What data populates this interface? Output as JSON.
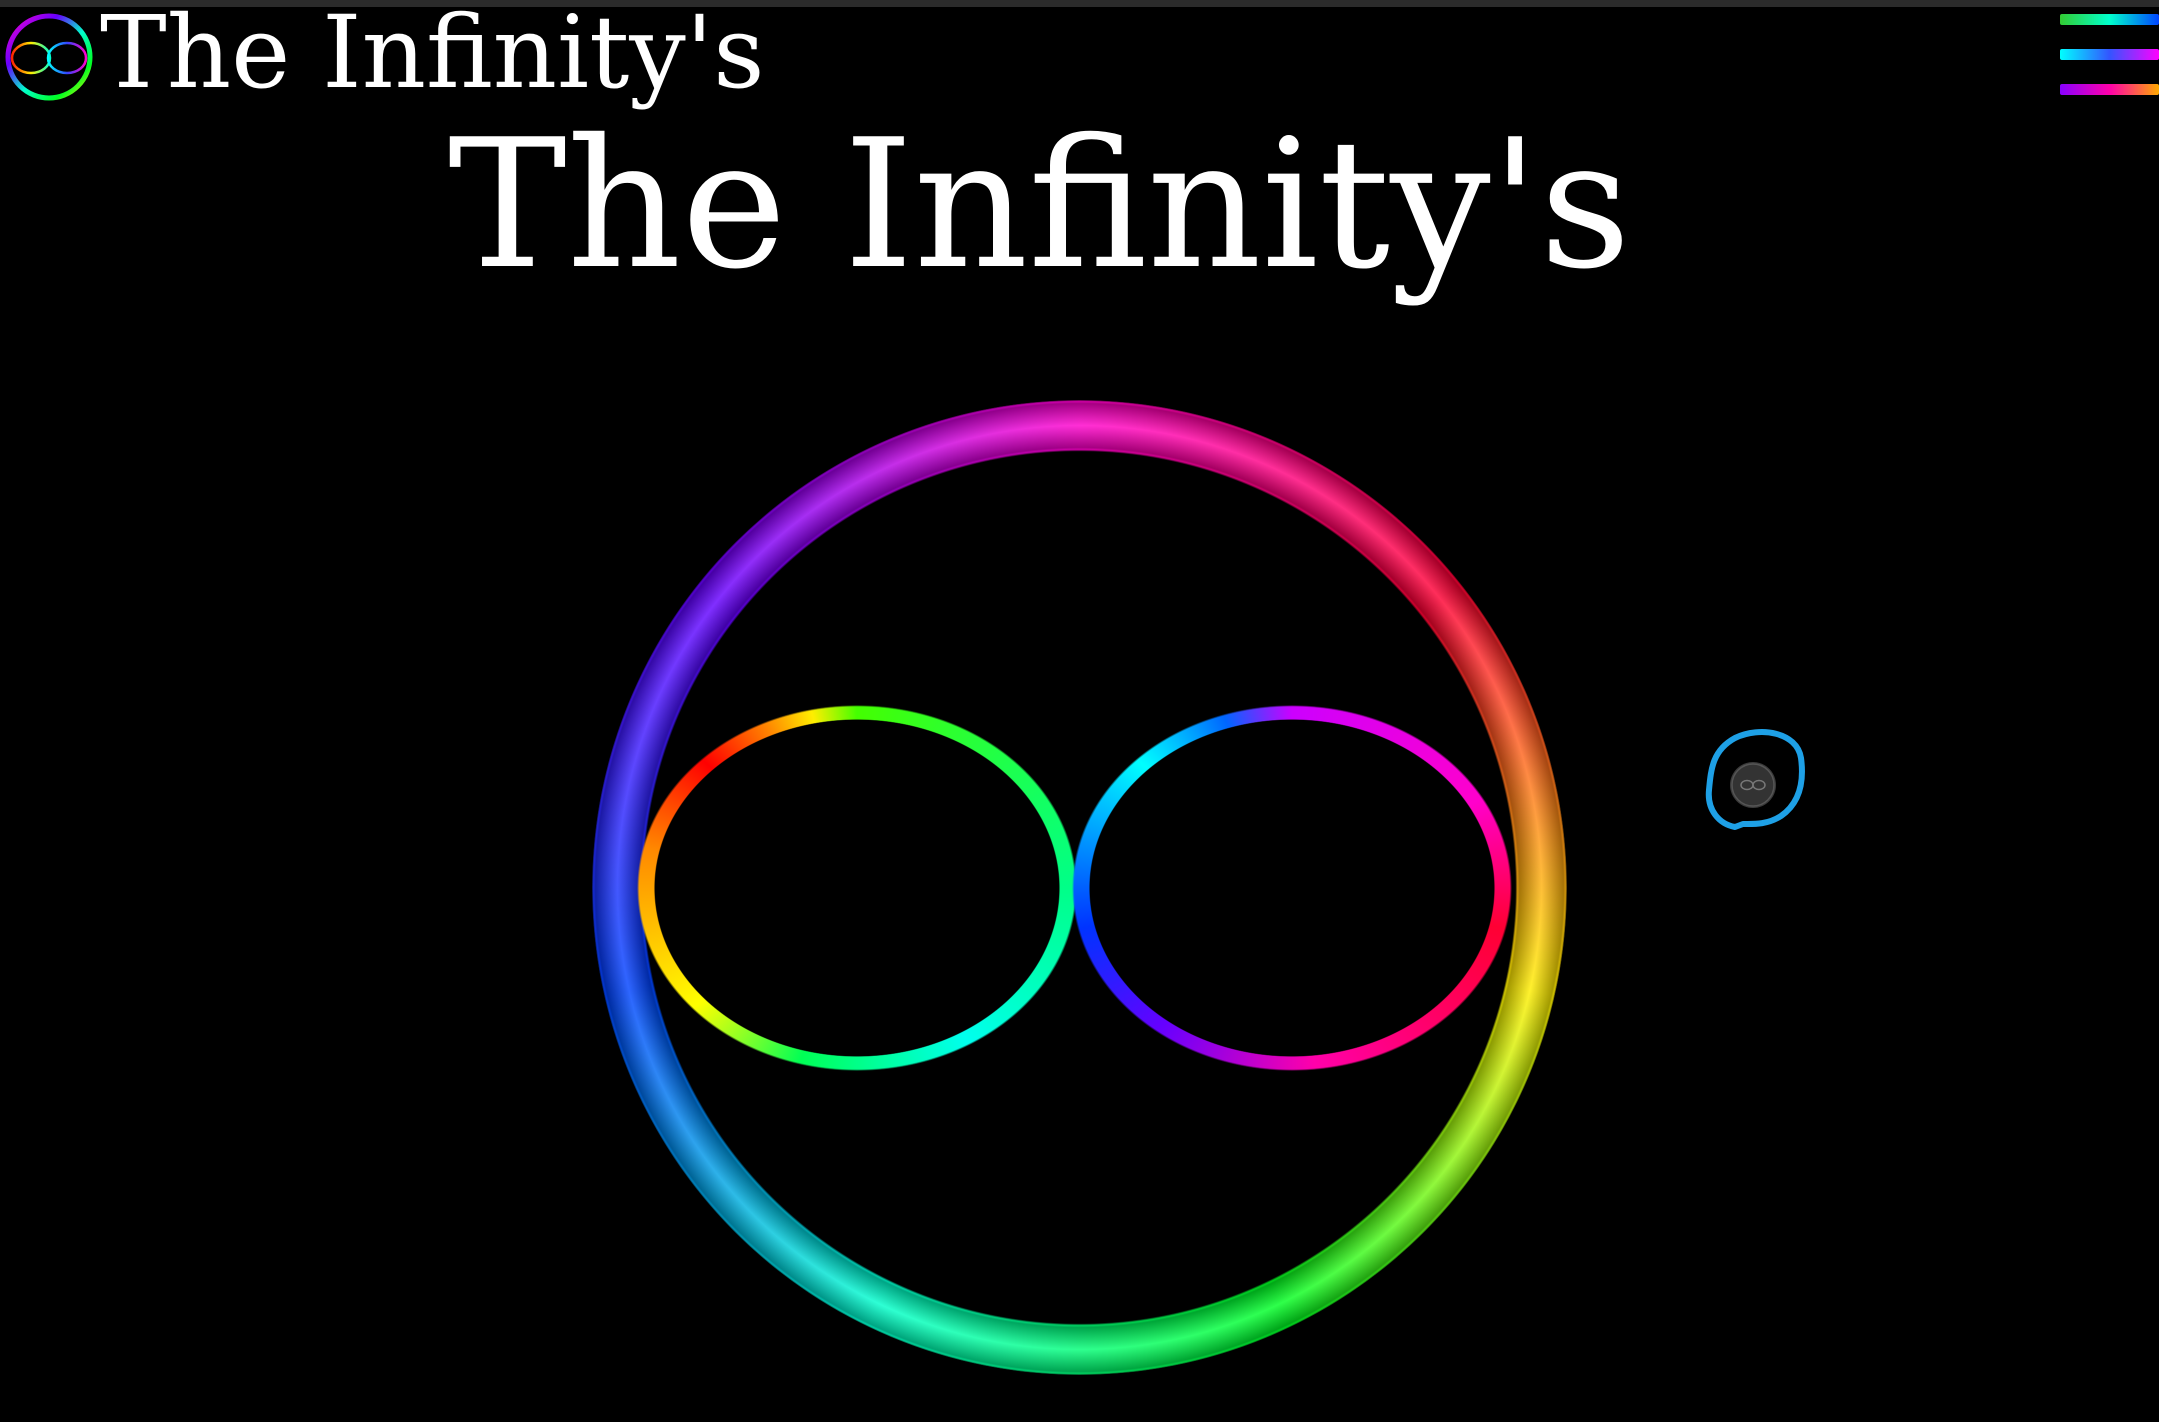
{
  "header": {
    "brand_text": "The Infinity's",
    "logo_icon": "infinity-ring-logo-icon",
    "menu_icon": "rainbow-hamburger-menu-icon"
  },
  "hero": {
    "title": "The Infinity's",
    "artwork_icon": "rainbow-infinity-in-ring-icon"
  },
  "floating_button": {
    "icon": "infinity-sketch-button-icon",
    "outline_color": "#1ea0e6"
  },
  "colors": {
    "background": "#000000",
    "text": "#ffffff",
    "top_strip": "#2b2b2b"
  }
}
